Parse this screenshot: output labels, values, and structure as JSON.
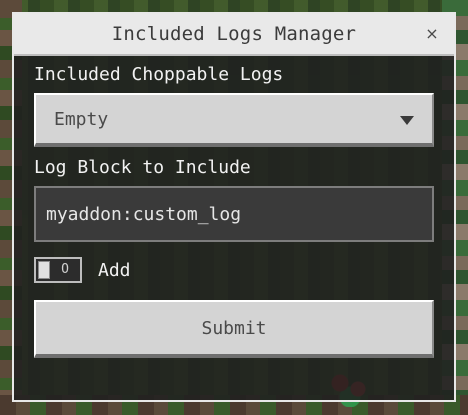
{
  "dialog": {
    "title": "Included Logs Manager",
    "close_symbol": "×"
  },
  "form": {
    "choppable_logs_label": "Included Choppable Logs",
    "choppable_logs_selected": "Empty",
    "log_block_label": "Log Block to Include",
    "log_block_value": "myaddon:custom_log",
    "toggle_state_text": "O",
    "toggle_label": "Add",
    "submit_label": "Submit"
  },
  "icons": {
    "close": "close-icon",
    "dropdown": "chevron-down-icon"
  },
  "colors": {
    "panel_header": "#e9e9e9",
    "panel_body": "#202020",
    "button_face": "#d4d4d4",
    "text_light": "#f2f2f2",
    "text_dark": "#4a4a4a"
  }
}
